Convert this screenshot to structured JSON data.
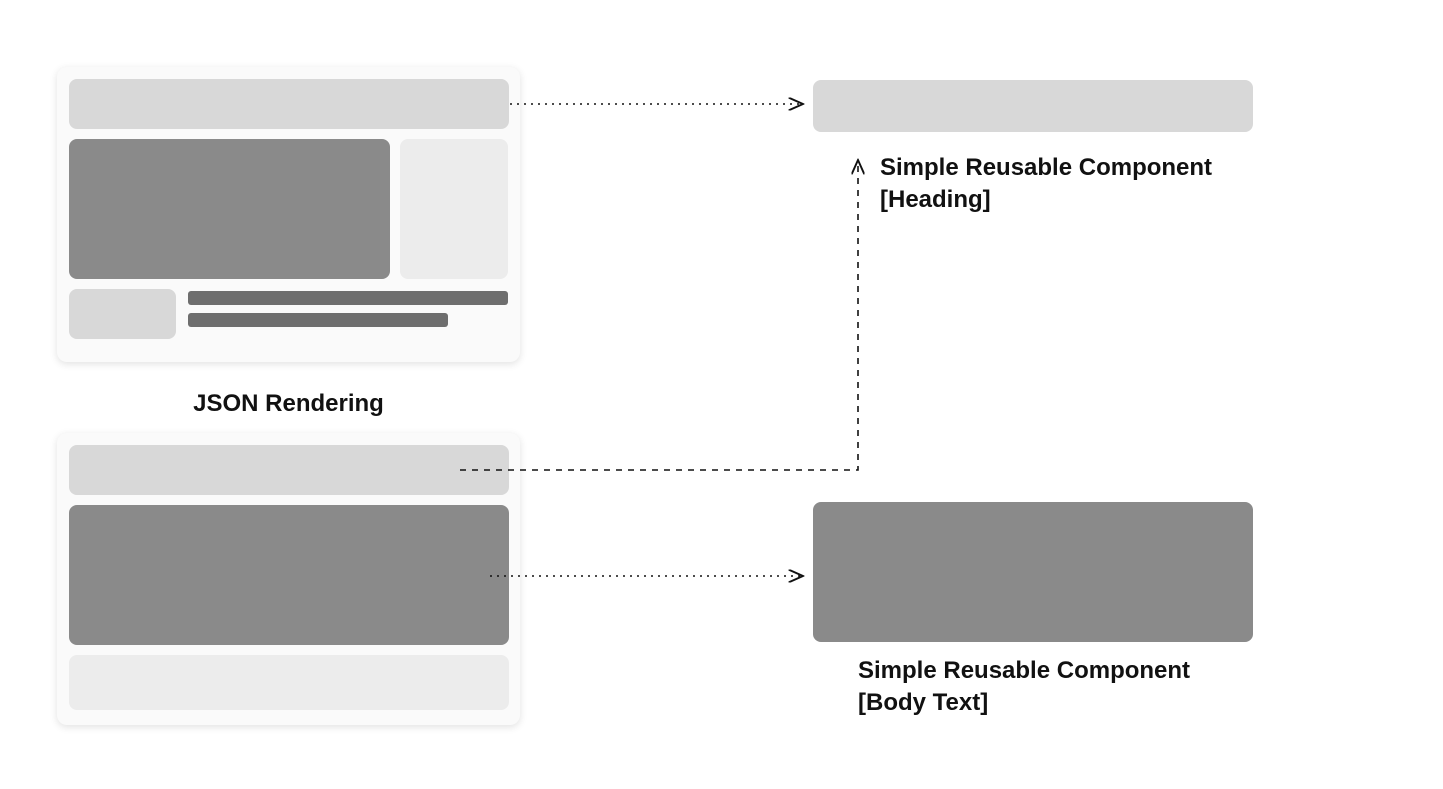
{
  "labels": {
    "json_rendering": "JSON Rendering",
    "component_heading_line1": "Simple Reusable Component",
    "component_heading_line2": "[Heading]",
    "component_body_line1": "Simple Reusable Component",
    "component_body_line2": "[Body Text]"
  },
  "diagram": {
    "left_cards": [
      {
        "name": "top-layout-wireframe",
        "blocks": [
          "heading-bar",
          "main-image",
          "side-panel",
          "thumbnail",
          "text-line",
          "text-line"
        ]
      },
      {
        "name": "bottom-layout-wireframe",
        "blocks": [
          "heading-bar",
          "body-text-block",
          "footer-bar"
        ]
      }
    ],
    "right_components": [
      {
        "name": "heading-component",
        "type": "heading-bar"
      },
      {
        "name": "body-component",
        "type": "body-text-block"
      }
    ],
    "arrows": [
      {
        "from": "top-layout-wireframe.heading-bar",
        "to": "heading-component"
      },
      {
        "from": "bottom-layout-wireframe.heading-bar",
        "to": "heading-component"
      },
      {
        "from": "bottom-layout-wireframe.body-text-block",
        "to": "body-component"
      }
    ]
  }
}
